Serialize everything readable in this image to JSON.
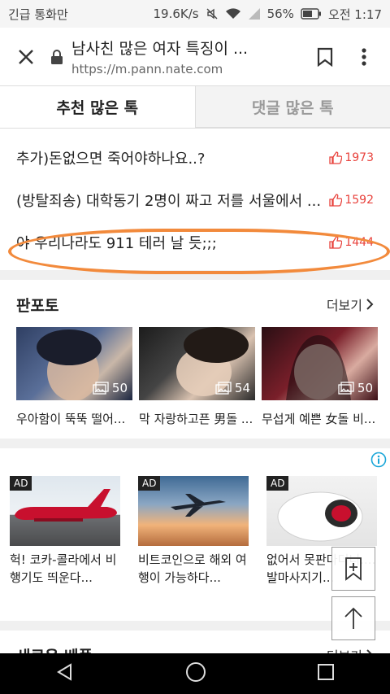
{
  "status_bar": {
    "left": "긴급 통화만",
    "speed": "19.6K/s",
    "battery": "56%",
    "time": "오전 1:17"
  },
  "browser": {
    "page_title": "남사친 많은 여자 특징이 ...",
    "url": "https://m.pann.nate.com"
  },
  "tabs": [
    {
      "label": "추천 많은 톡"
    },
    {
      "label": "댓글 많은 톡"
    }
  ],
  "ranked": [
    {
      "title": "추가)돈없으면 죽어야하나요..?",
      "likes": "1973"
    },
    {
      "title": "(방탈죄송) 대학동기 2명이 짜고 저를 서울에서 ...",
      "likes": "1592"
    },
    {
      "title": "야 우리나라도 911 테러 날 듯;;;",
      "likes": "1444"
    }
  ],
  "panphoto": {
    "title": "판포토",
    "more": "더보기",
    "items": [
      {
        "count": "50",
        "caption": "우아함이 뚝뚝 떨어..."
      },
      {
        "count": "54",
        "caption": "막 자랑하고픈 男돌 ..."
      },
      {
        "count": "50",
        "caption": "무섭게 예쁜 女돌 비..."
      }
    ]
  },
  "ads": {
    "badge": "AD",
    "items": [
      {
        "caption": "헉! 코카-콜라에서 비행기도 띄운다..."
      },
      {
        "caption": "비트코인으로 해외 여행이 가능하다..."
      },
      {
        "caption": "없어서 못판다더니.... 발마사지기..."
      }
    ]
  },
  "new_best": {
    "title": "새로운 베플",
    "more": "더보기"
  },
  "colors": {
    "accent": "#e8423c",
    "highlight": "#f28a3c"
  }
}
